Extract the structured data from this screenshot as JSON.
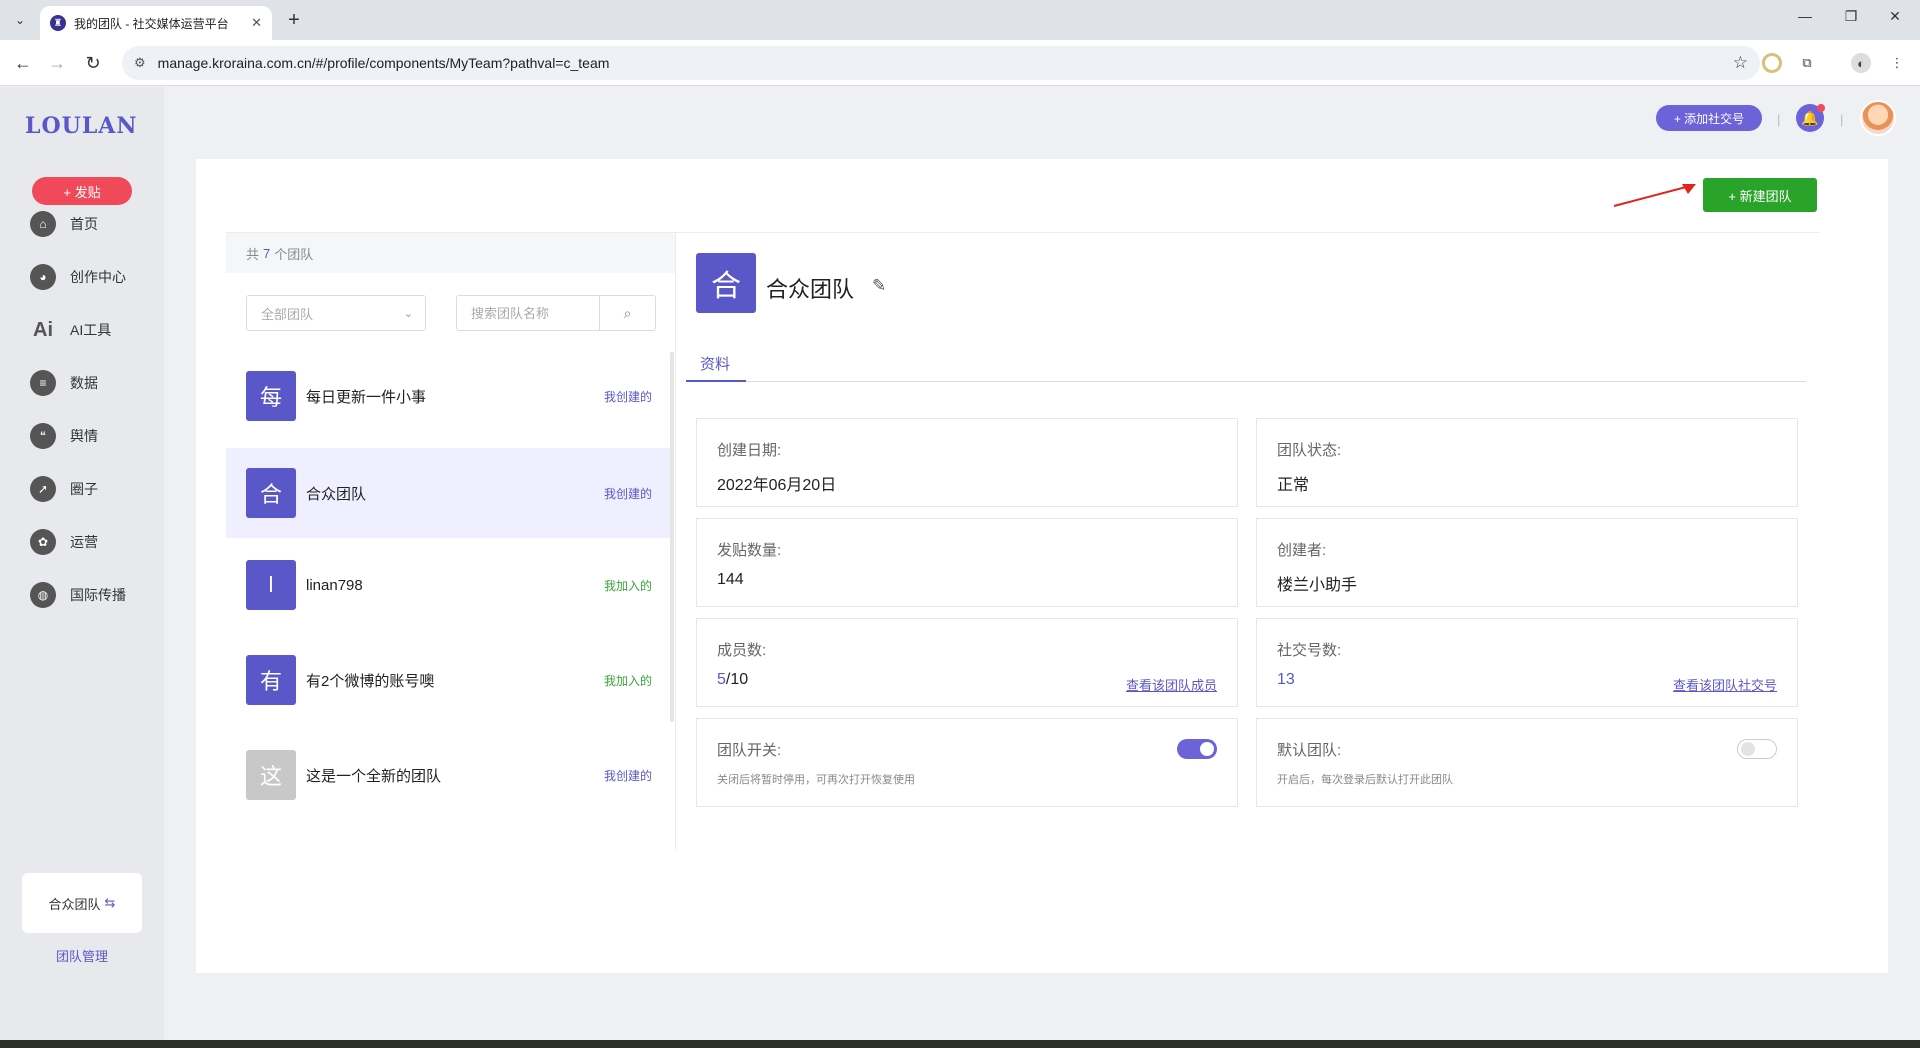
{
  "browser": {
    "tab_title": "我的团队 - 社交媒体运营平台",
    "url": "manage.kroraina.com.cn/#/profile/components/MyTeam?pathval=c_team"
  },
  "sidebar": {
    "logo": "LOULAN",
    "post_button": "+ 发贴",
    "items": [
      {
        "label": "首页",
        "icon": "home-icon"
      },
      {
        "label": "创作中心",
        "icon": "palette-icon"
      },
      {
        "label": "AI工具",
        "icon": "ai-icon"
      },
      {
        "label": "数据",
        "icon": "database-icon"
      },
      {
        "label": "舆情",
        "icon": "quote-icon"
      },
      {
        "label": "圈子",
        "icon": "compass-icon"
      },
      {
        "label": "运营",
        "icon": "operations-icon"
      },
      {
        "label": "国际传播",
        "icon": "globe-icon"
      }
    ],
    "current_team": "合众团队",
    "team_manage": "团队管理"
  },
  "header": {
    "add_social_button": "+ 添加社交号"
  },
  "main": {
    "new_team_button": "+ 新建团队",
    "list": {
      "count_prefix": "共",
      "count": "7",
      "count_suffix": "个团队",
      "filter_value": "全部团队",
      "search_placeholder": "搜索团队名称",
      "teams": [
        {
          "initial": "每",
          "name": "每日更新一件小事",
          "tag": "我创建的"
        },
        {
          "initial": "合",
          "name": "合众团队",
          "tag": "我创建的"
        },
        {
          "initial": "l",
          "name": "linan798",
          "tag": "我加入的"
        },
        {
          "initial": "有",
          "name": "有2个微博的账号噢",
          "tag": "我加入的"
        },
        {
          "initial": "这",
          "name": "这是一个全新的团队",
          "tag": "我创建的"
        }
      ]
    },
    "detail": {
      "initial": "合",
      "name": "合众团队",
      "tab": "资料",
      "created_label": "创建日期:",
      "created_value": "2022年06月20日",
      "status_label": "团队状态:",
      "status_value": "正常",
      "posts_label": "发贴数量:",
      "posts_value": "144",
      "creator_label": "创建者:",
      "creator_value": "楼兰小助手",
      "members_label": "成员数:",
      "members_current": "5",
      "members_total": "/10",
      "members_link": "查看该团队成员",
      "social_label": "社交号数:",
      "social_value": "13",
      "social_link": "查看该团队社交号",
      "switch_label": "团队开关:",
      "switch_note": "关闭后将暂时停用，可再次打开恢复使用",
      "default_label": "默认团队:",
      "default_note": "开启后，每次登录后默认打开此团队"
    }
  },
  "colors": {
    "accent": "#5a57c8",
    "post_red": "#f04a5a",
    "new_team_green": "#2aa32a",
    "joined_green": "#3aa63a"
  }
}
